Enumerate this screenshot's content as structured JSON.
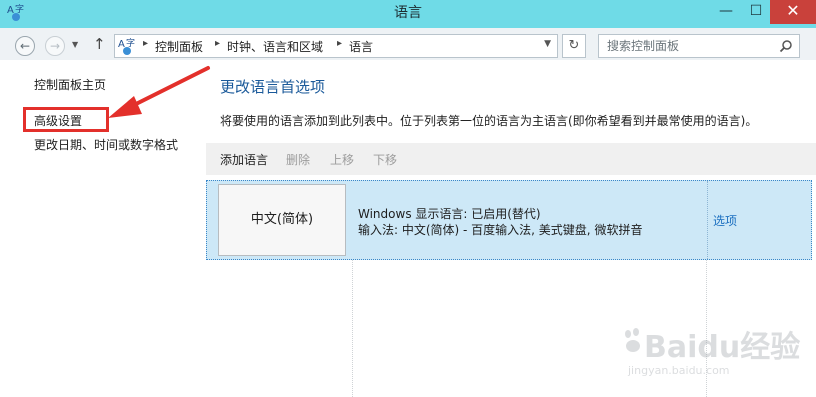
{
  "window": {
    "title": "语言",
    "minimize": "—",
    "maximize": "☐",
    "close": "✕"
  },
  "addressbar": {
    "breadcrumbs": [
      "控制面板",
      "时钟、语言和区域",
      "语言"
    ],
    "search_placeholder": "搜索控制面板"
  },
  "sidebar": {
    "links": [
      "控制面板主页",
      "高级设置",
      "更改日期、时间或数字格式"
    ],
    "highlighted": "高级设置"
  },
  "main": {
    "title": "更改语言首选项",
    "description": "将要使用的语言添加到此列表中。位于列表第一位的语言为主语言(即你希望看到并最常使用的语言)。",
    "toolbar": {
      "add": "添加语言",
      "remove": "删除",
      "up": "上移",
      "down": "下移"
    },
    "languages": [
      {
        "name": "中文(简体)",
        "display_language": "Windows 显示语言: 已启用(替代)",
        "input_methods": "输入法: 中文(简体) - 百度输入法, 美式键盘, 微软拼音",
        "options": "选项"
      }
    ]
  },
  "watermark": {
    "brand": "Baidu经验",
    "url": "jingyan.baidu.com"
  },
  "colors": {
    "titlebar": "#6fdbe7",
    "link": "#1b5a9a",
    "selection": "#cde8f7",
    "highlight": "#e3302b"
  }
}
